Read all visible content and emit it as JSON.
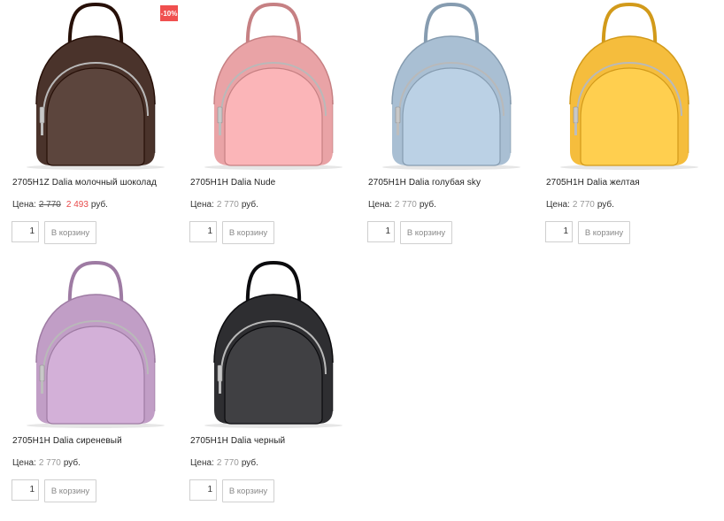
{
  "products": [
    {
      "name": "2705H1Z Dalia молочный шоколад",
      "price_label": "Цена:",
      "old_price": "2 770",
      "price": "2 493",
      "currency": "руб.",
      "badge": "-10%",
      "quantity": "1",
      "cart_label": "В корзину",
      "color": "#4a332b"
    },
    {
      "name": "2705H1H Dalia Nude",
      "price_label": "Цена:",
      "price": "2 770",
      "currency": "руб.",
      "quantity": "1",
      "cart_label": "В корзину",
      "color": "#e9a3a6"
    },
    {
      "name": "2705H1H Dalia голубая sky",
      "price_label": "Цена:",
      "price": "2 770",
      "currency": "руб.",
      "quantity": "1",
      "cart_label": "В корзину",
      "color": "#a9bfd3"
    },
    {
      "name": "2705H1H Dalia желтая",
      "price_label": "Цена:",
      "price": "2 770",
      "currency": "руб.",
      "quantity": "1",
      "cart_label": "В корзину",
      "color": "#f5bd3d"
    },
    {
      "name": "2705H1H Dalia сиреневый",
      "price_label": "Цена:",
      "price": "2 770",
      "currency": "руб.",
      "quantity": "1",
      "cart_label": "В корзину",
      "color": "#c19ec6"
    },
    {
      "name": "2705H1H Dalia черный",
      "price_label": "Цена:",
      "price": "2 770",
      "currency": "руб.",
      "quantity": "1",
      "cart_label": "В корзину",
      "color": "#2e2e31"
    }
  ]
}
